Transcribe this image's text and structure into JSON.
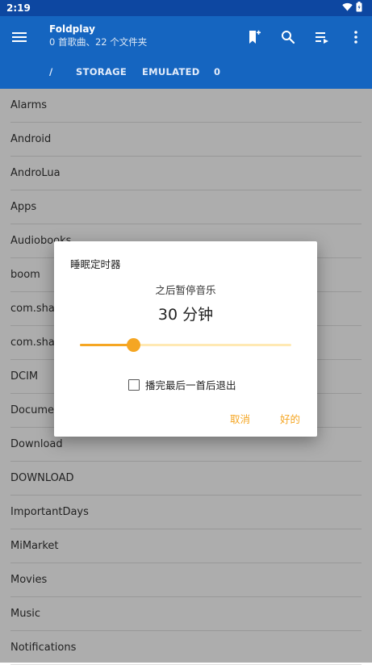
{
  "status_bar": {
    "time": "2:19"
  },
  "app_bar": {
    "title": "Foldplay",
    "subtitle": "0 首歌曲、22 个文件夹"
  },
  "breadcrumb": [
    "/",
    "STORAGE",
    "EMULATED",
    "0"
  ],
  "folders": [
    "Alarms",
    "Android",
    "AndroLua",
    "Apps",
    "Audiobooks",
    "boom",
    "com.sha",
    "com.sha",
    "DCIM",
    "Docume",
    "Download",
    "DOWNLOAD",
    "ImportantDays",
    "MiMarket",
    "Movies",
    "Music",
    "Notifications"
  ],
  "dialog": {
    "title": "睡眠定时器",
    "subtitle": "之后暂停音乐",
    "value": "30 分钟",
    "slider_fraction": 0.25,
    "checkbox_label": "播完最后一首后退出",
    "checkbox_checked": false,
    "cancel_label": "取消",
    "ok_label": "好的"
  },
  "colors": {
    "app_bar": "#1565c0",
    "status_bar": "#0d47a1",
    "accent": "#f5a623"
  }
}
